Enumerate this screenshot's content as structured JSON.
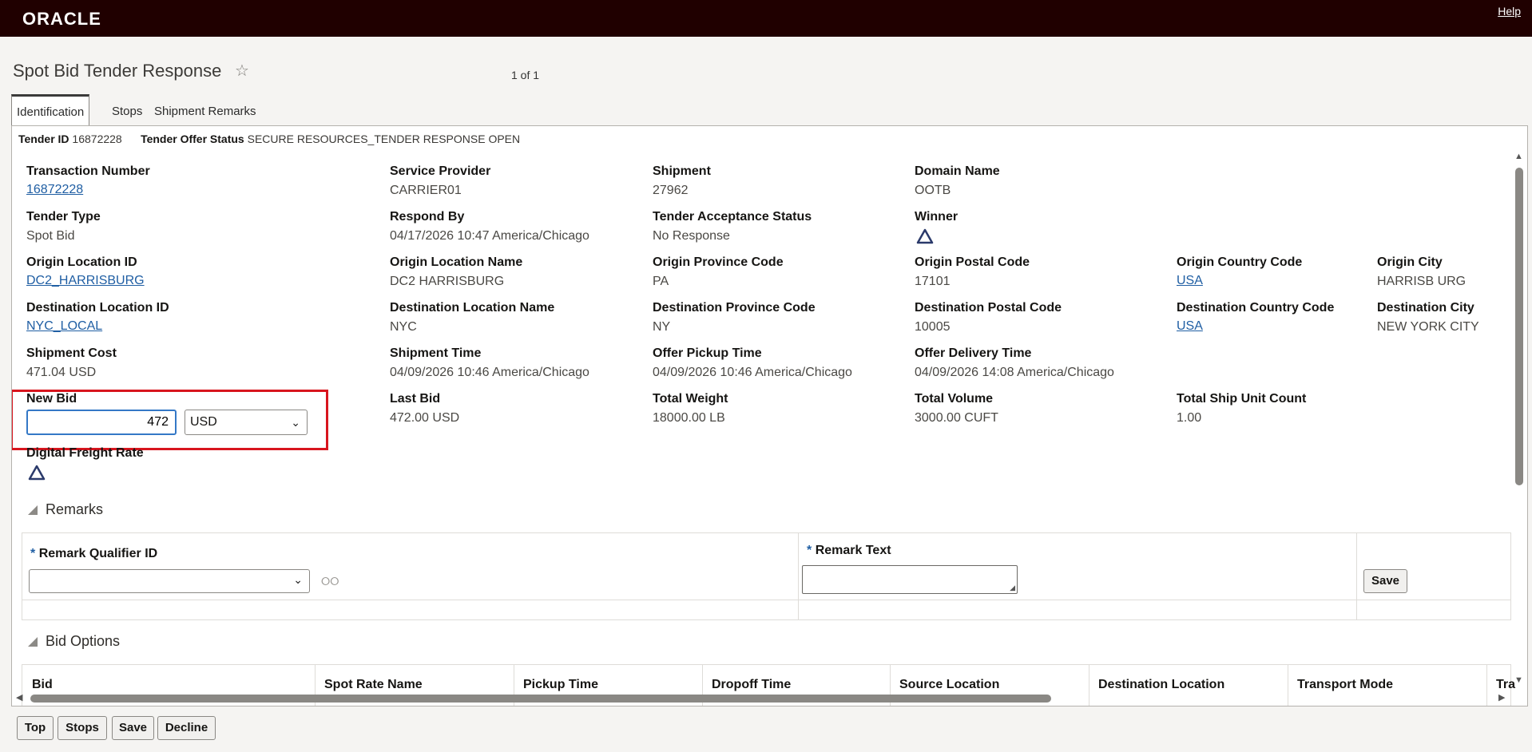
{
  "header": {
    "logo": "ORACLE",
    "help_label": "Help"
  },
  "page": {
    "title": "Spot Bid Tender Response",
    "pager": "1 of 1"
  },
  "tabs": [
    {
      "label": "Identification",
      "active": true
    },
    {
      "label": "Stops",
      "active": false
    },
    {
      "label": "Shipment Remarks",
      "active": false
    }
  ],
  "summary": {
    "tender_id_label": "Tender ID",
    "tender_id": "16872228",
    "status_label": "Tender Offer Status",
    "status": "SECURE RESOURCES_TENDER RESPONSE OPEN"
  },
  "fields": {
    "transaction_number": {
      "label": "Transaction Number",
      "value": "16872228"
    },
    "service_provider": {
      "label": "Service Provider",
      "value": "CARRIER01"
    },
    "shipment": {
      "label": "Shipment",
      "value": "27962"
    },
    "domain_name": {
      "label": "Domain Name",
      "value": "OOTB"
    },
    "tender_type": {
      "label": "Tender Type",
      "value": "Spot Bid"
    },
    "respond_by": {
      "label": "Respond By",
      "value": "04/17/2026 10:47 America/Chicago"
    },
    "tender_acceptance_status": {
      "label": "Tender Acceptance Status",
      "value": "No Response"
    },
    "winner": {
      "label": "Winner",
      "icon": "warning-triangle-icon"
    },
    "origin_location_id": {
      "label": "Origin Location ID",
      "value": "DC2_HARRISBURG"
    },
    "origin_location_name": {
      "label": "Origin Location Name",
      "value": "DC2 HARRISBURG"
    },
    "origin_province_code": {
      "label": "Origin Province Code",
      "value": "PA"
    },
    "origin_postal_code": {
      "label": "Origin Postal Code",
      "value": "17101"
    },
    "origin_country_code": {
      "label": "Origin Country Code",
      "value": "USA"
    },
    "origin_city": {
      "label": "Origin City",
      "value": "HARRISB URG"
    },
    "destination_location_id": {
      "label": "Destination Location ID",
      "value": "NYC_LOCAL"
    },
    "destination_location_name": {
      "label": "Destination Location Name",
      "value": "NYC"
    },
    "destination_province_code": {
      "label": "Destination Province Code",
      "value": "NY"
    },
    "destination_postal_code": {
      "label": "Destination Postal Code",
      "value": "10005"
    },
    "destination_country_code": {
      "label": "Destination Country Code",
      "value": "USA"
    },
    "destination_city": {
      "label": "Destination City",
      "value": "NEW YORK CITY"
    },
    "shipment_cost": {
      "label": "Shipment Cost",
      "value": "471.04 USD"
    },
    "shipment_time": {
      "label": "Shipment Time",
      "value": "04/09/2026 10:46 America/Chicago"
    },
    "offer_pickup_time": {
      "label": "Offer Pickup Time",
      "value": "04/09/2026 10:46 America/Chicago"
    },
    "offer_delivery_time": {
      "label": "Offer Delivery Time",
      "value": "04/09/2026 14:08 America/Chicago"
    },
    "new_bid": {
      "label": "New Bid",
      "value": "472",
      "currency": "USD"
    },
    "last_bid": {
      "label": "Last Bid",
      "value": "472.00 USD"
    },
    "total_weight": {
      "label": "Total Weight",
      "value": "18000.00 LB"
    },
    "total_volume": {
      "label": "Total Volume",
      "value": "3000.00 CUFT"
    },
    "total_ship_unit_count": {
      "label": "Total Ship Unit Count",
      "value": "1.00"
    },
    "digital_freight_rate": {
      "label": "Digital Freight Rate",
      "icon": "warning-triangle-icon"
    }
  },
  "remarks": {
    "title": "Remarks",
    "required_mark": "*",
    "qualifier_label": "Remark Qualifier ID",
    "text_label": "Remark Text",
    "save_label": "Save"
  },
  "bid_options": {
    "title": "Bid Options",
    "columns": [
      "Bid",
      "Spot Rate Name",
      "Pickup Time",
      "Dropoff Time",
      "Source Location",
      "Destination Location",
      "Transport Mode",
      "Tra"
    ]
  },
  "footer": {
    "buttons": [
      "Top",
      "Stops",
      "Save",
      "Decline"
    ]
  }
}
